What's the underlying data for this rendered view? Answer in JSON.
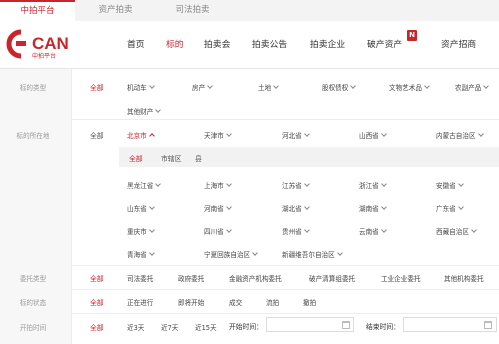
{
  "platform_tabs": [
    "中拍平台",
    "资产拍卖",
    "司法拍卖"
  ],
  "logo": {
    "text": "CAN",
    "subtext": "中拍平台"
  },
  "nav": [
    "首页",
    "标的",
    "拍卖会",
    "拍卖公告",
    "拍卖企业",
    "破产资产",
    "资产招商"
  ],
  "nav_badge": "N",
  "filters": {
    "type": {
      "label": "标的类型",
      "all": "全部",
      "options": [
        "机动车",
        "房产",
        "土地",
        "股权债权",
        "文物艺术品",
        "农副产品",
        "其他财产"
      ]
    },
    "location": {
      "label": "标的所在地",
      "all": "全部",
      "selected": "北京市",
      "sub_options": [
        "全部",
        "市辖区",
        "县"
      ],
      "provinces": [
        "北京市",
        "天津市",
        "河北省",
        "山西省",
        "内蒙古自治区",
        "黑龙江省",
        "上海市",
        "江苏省",
        "浙江省",
        "安徽省",
        "山东省",
        "河南省",
        "湖北省",
        "湖南省",
        "广东省",
        "重庆市",
        "四川省",
        "贵州省",
        "云南省",
        "西藏自治区",
        "青海省",
        "宁夏回族自治区",
        "新疆维吾尔自治区"
      ]
    },
    "consignor": {
      "label": "委托类型",
      "all": "全部",
      "options": [
        "司法委托",
        "政府委托",
        "金融资产机构委托",
        "破产清算组委托",
        "工业企业委托",
        "其他机构委托"
      ]
    },
    "status": {
      "label": "标的状态",
      "all": "全部",
      "options": [
        "正在进行",
        "即将开始",
        "成交",
        "流拍",
        "撤拍"
      ]
    },
    "start_time": {
      "label": "开拍时间",
      "all": "全部",
      "options": [
        "近3天",
        "近7天",
        "近15天"
      ],
      "start_label": "开始时间：",
      "end_label": "结束时间："
    }
  },
  "colors": {
    "accent": "#c9252c"
  }
}
